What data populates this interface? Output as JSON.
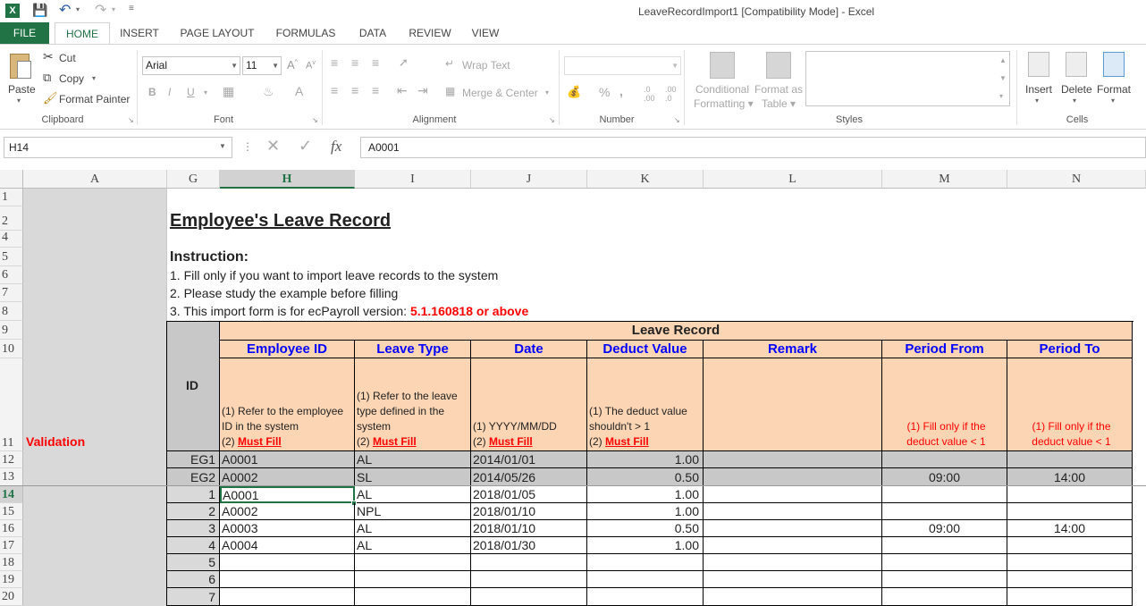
{
  "window": {
    "title": "LeaveRecordImport1  [Compatibility Mode] - Excel"
  },
  "quick_access": {
    "save_icon": "save-icon",
    "undo_icon": "undo-icon",
    "redo_icon": "redo-icon"
  },
  "tabs": [
    "FILE",
    "HOME",
    "INSERT",
    "PAGE LAYOUT",
    "FORMULAS",
    "DATA",
    "REVIEW",
    "VIEW"
  ],
  "ribbon": {
    "clipboard": {
      "paste": "Paste",
      "cut": "Cut",
      "copy": "Copy",
      "format_painter": "Format Painter",
      "label": "Clipboard"
    },
    "font": {
      "family": "Arial",
      "size": "11",
      "bold": "B",
      "italic": "I",
      "underline": "U",
      "label": "Font"
    },
    "alignment": {
      "wrap_text": "Wrap Text",
      "merge_center": "Merge & Center",
      "label": "Alignment"
    },
    "number": {
      "percent": "%",
      "comma": ",",
      "label": "Number"
    },
    "styles": {
      "conditional_1": "Conditional",
      "conditional_2": "Formatting",
      "format_as_1": "Format as",
      "format_as_2": "Table",
      "label": "Styles"
    },
    "cells": {
      "insert": "Insert",
      "delete": "Delete",
      "format": "Format",
      "label": "Cells"
    }
  },
  "formula_bar": {
    "name_box": "H14",
    "fx": "fx",
    "value": "A0001"
  },
  "columns": [
    "A",
    "G",
    "H",
    "I",
    "J",
    "K",
    "L",
    "M",
    "N"
  ],
  "rows": [
    "1",
    "2",
    "4",
    "5",
    "6",
    "7",
    "8",
    "9",
    "10",
    "11",
    "12",
    "13",
    "14",
    "15",
    "16",
    "17",
    "18",
    "19",
    "20"
  ],
  "sheet": {
    "title": "Employee's Leave Record",
    "instruction_heading": "Instruction:",
    "instruction_1": "1. Fill only if you want to import leave records to the system",
    "instruction_2": "2. Please study the example before filling",
    "instruction_3_prefix": "3. This import form is for ecPayroll version: ",
    "instruction_3_version": "5.1.160818 or above",
    "validation": "Validation",
    "id_header": "ID",
    "group_header": "Leave Record",
    "headers": [
      "Employee ID",
      "Leave Type",
      "Date",
      "Deduct Value",
      "Remark",
      "Period From",
      "Period To"
    ],
    "desc": {
      "emp_id": "(1) Refer to the employee ID in the system",
      "leave_type": "(1) Refer to the leave type defined in the system",
      "date": "(1) YYYY/MM/DD",
      "deduct": "(1) The deduct value shouldn't > 1",
      "must_prefix": "(2) ",
      "must_fill": "Must Fill",
      "period_from": "(1) Fill only if the deduct value < 1",
      "period_to": "(1) Fill only if the deduct value < 1"
    },
    "examples": [
      {
        "id": "EG1",
        "emp": "A0001",
        "type": "AL",
        "date": "2014/01/01",
        "deduct": "1.00",
        "remark": "",
        "from": "",
        "to": ""
      },
      {
        "id": "EG2",
        "emp": "A0002",
        "type": "SL",
        "date": "2014/05/26",
        "deduct": "0.50",
        "remark": "",
        "from": "09:00",
        "to": "14:00"
      }
    ],
    "data_rows": [
      {
        "id": "1",
        "emp": "A0001",
        "type": "AL",
        "date": "2018/01/05",
        "deduct": "1.00",
        "remark": "",
        "from": "",
        "to": ""
      },
      {
        "id": "2",
        "emp": "A0002",
        "type": "NPL",
        "date": "2018/01/10",
        "deduct": "1.00",
        "remark": "",
        "from": "",
        "to": ""
      },
      {
        "id": "3",
        "emp": "A0003",
        "type": "AL",
        "date": "2018/01/10",
        "deduct": "0.50",
        "remark": "",
        "from": "09:00",
        "to": "14:00"
      },
      {
        "id": "4",
        "emp": "A0004",
        "type": "AL",
        "date": "2018/01/30",
        "deduct": "1.00",
        "remark": "",
        "from": "",
        "to": ""
      },
      {
        "id": "5",
        "emp": "",
        "type": "",
        "date": "",
        "deduct": "",
        "remark": "",
        "from": "",
        "to": ""
      },
      {
        "id": "6",
        "emp": "",
        "type": "",
        "date": "",
        "deduct": "",
        "remark": "",
        "from": "",
        "to": ""
      },
      {
        "id": "7",
        "emp": "",
        "type": "",
        "date": "",
        "deduct": "",
        "remark": "",
        "from": "",
        "to": ""
      }
    ]
  },
  "colors": {
    "excel_green": "#217346",
    "orange_fill": "#fcd5b4",
    "grey_fill": "#c8c8c8",
    "header_blue": "#0000ff",
    "red": "#ff0000"
  }
}
